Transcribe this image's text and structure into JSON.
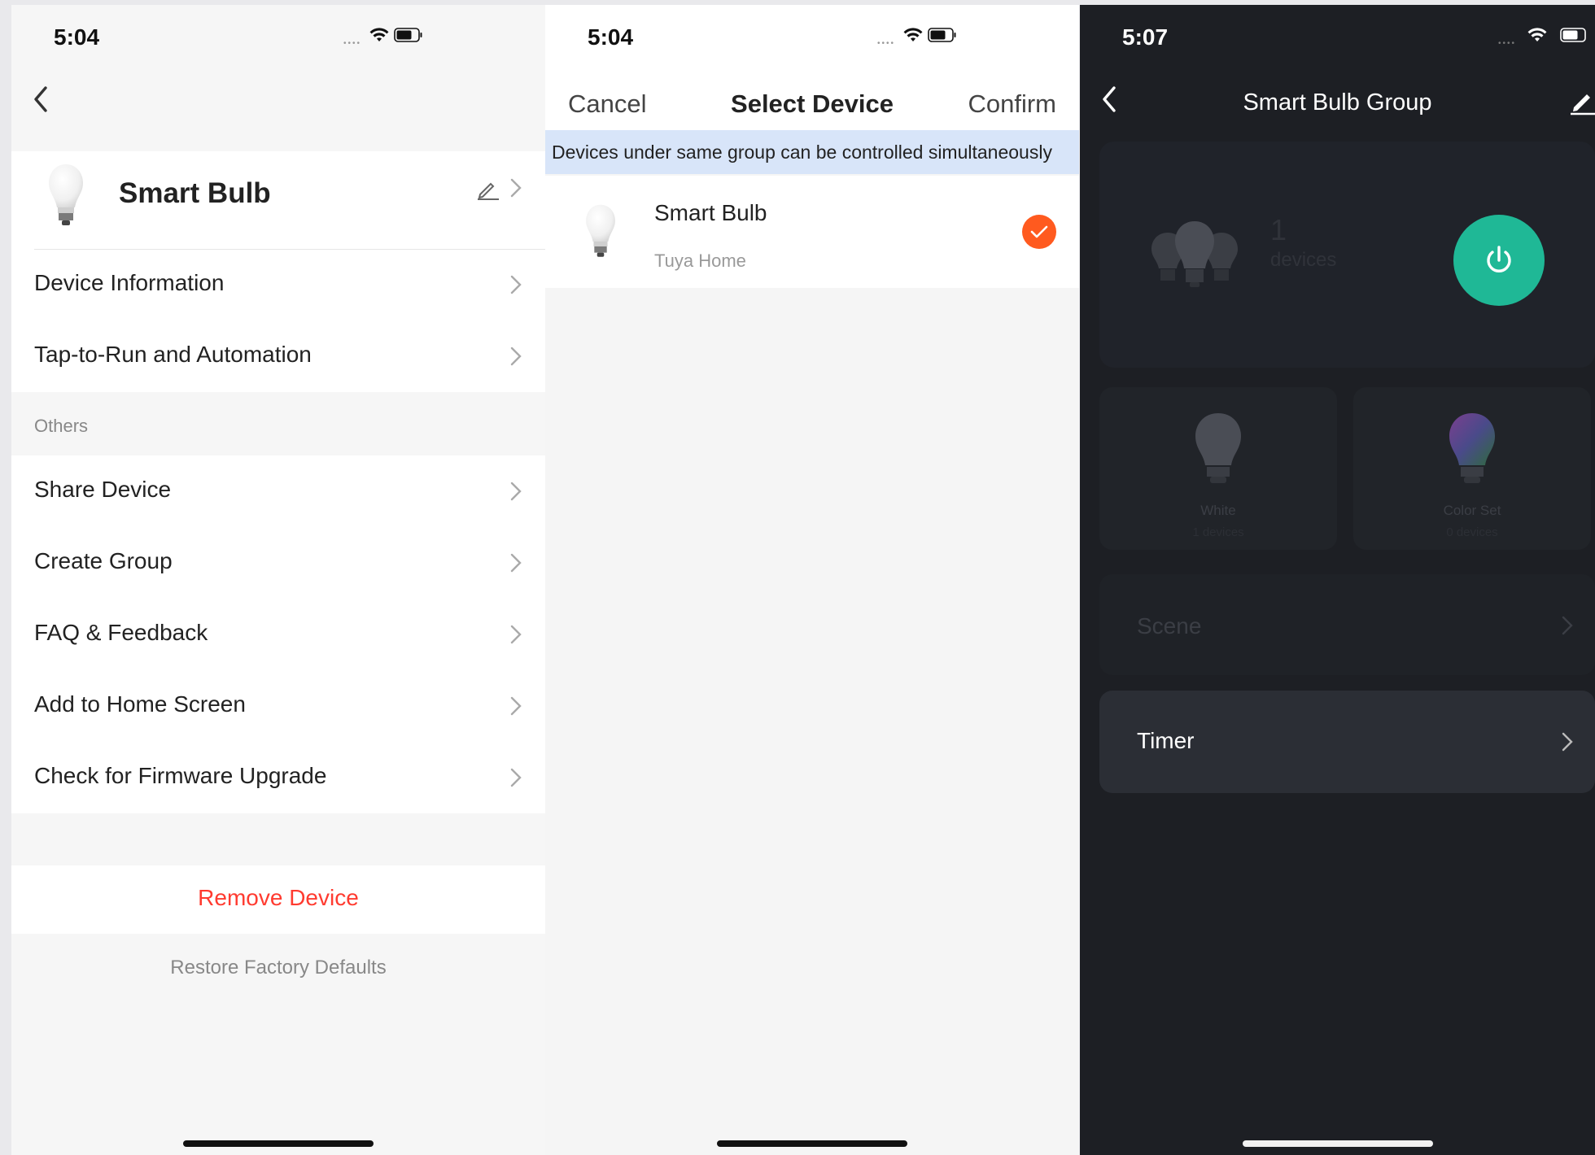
{
  "screen1": {
    "status_time": "5:04",
    "device_name": "Smart Bulb",
    "rows_top": [
      "Device Information",
      "Tap-to-Run and Automation"
    ],
    "section_header": "Others",
    "rows_others": [
      "Share Device",
      "Create Group",
      "FAQ & Feedback",
      "Add to Home Screen",
      "Check for Firmware Upgrade"
    ],
    "remove_label": "Remove Device",
    "restore_label": "Restore Factory Defaults"
  },
  "screen2": {
    "status_time": "5:04",
    "cancel_label": "Cancel",
    "title": "Select Device",
    "confirm_label": "Confirm",
    "banner": "Devices under same group can be controlled simultaneously",
    "device": {
      "name": "Smart Bulb",
      "home": "Tuya Home",
      "checked": true
    }
  },
  "screen3": {
    "status_time": "5:07",
    "title": "Smart Bulb Group",
    "device_count": "1",
    "device_count_label": "devices",
    "modes": [
      {
        "label": "White",
        "count": "1 devices"
      },
      {
        "label": "Color Set",
        "count": "0 devices"
      }
    ],
    "scene_label": "Scene",
    "timer_label": "Timer",
    "power_color": "#1fb896"
  },
  "colors": {
    "accent_orange": "#ff5a1f",
    "remove_red": "#ff3b30",
    "banner_blue": "#d8e5f9"
  }
}
